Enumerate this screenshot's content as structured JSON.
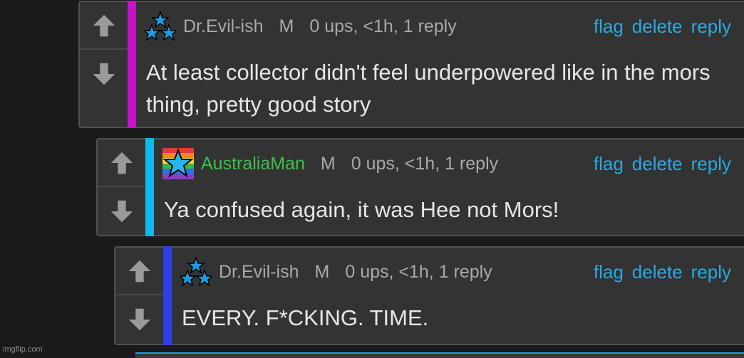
{
  "comments": [
    {
      "username": "Dr.Evil-ish",
      "badge": "M",
      "meta": "0 ups, <1h, 1 reply",
      "text": "At least collector didn't feel underpowered like in the mors thing, pretty good story",
      "stripe_color": "#c613c6",
      "username_color": "#a9a9a9",
      "avatar": "three-stars-icon"
    },
    {
      "username": "AustraliaMan",
      "badge": "M",
      "meta": "0 ups, <1h, 1 reply",
      "text": "Ya confused again, it was Hee not Mors!",
      "stripe_color": "#12b7ee",
      "username_color": "#3fbf4a",
      "avatar": "rainbow-star-icon"
    },
    {
      "username": "Dr.Evil-ish",
      "badge": "M",
      "meta": "0 ups, <1h, 1 reply",
      "text": "EVERY. F*CKING. TIME.",
      "stripe_color": "#2f3fe6",
      "username_color": "#a9a9a9",
      "avatar": "three-stars-icon"
    }
  ],
  "actions": {
    "flag": "flag",
    "delete": "delete",
    "reply": "reply"
  },
  "colors": {
    "action": "#2aa9e0",
    "background": "#1a1a1a",
    "panel": "#333333"
  },
  "watermark": "imgflip.com"
}
